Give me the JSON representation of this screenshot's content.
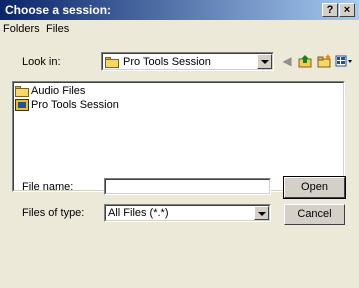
{
  "window": {
    "title": "Choose a session:",
    "help_label": "?",
    "close_label": "×"
  },
  "menus": [
    "Folders",
    "Files"
  ],
  "look_in": {
    "label": "Look in:",
    "value": "Pro Tools Session"
  },
  "toolbar": {
    "back_icon": "back-icon",
    "up_icon": "up-folder-icon",
    "new_folder_icon": "new-folder-icon",
    "views_icon": "views-menu-icon"
  },
  "files": [
    {
      "name": "Audio Files",
      "icon": "folder-icon"
    },
    {
      "name": "Pro Tools Session",
      "icon": "pro-tools-session-icon"
    }
  ],
  "file_name": {
    "label": "File name:",
    "value": ""
  },
  "file_type": {
    "label": "Files of type:",
    "value": "All Files (*.*)"
  },
  "buttons": {
    "open": "Open",
    "cancel": "Cancel"
  },
  "colors": {
    "title_start": "#0a246a",
    "title_end": "#a6caf0",
    "face": "#d4d0c8"
  }
}
